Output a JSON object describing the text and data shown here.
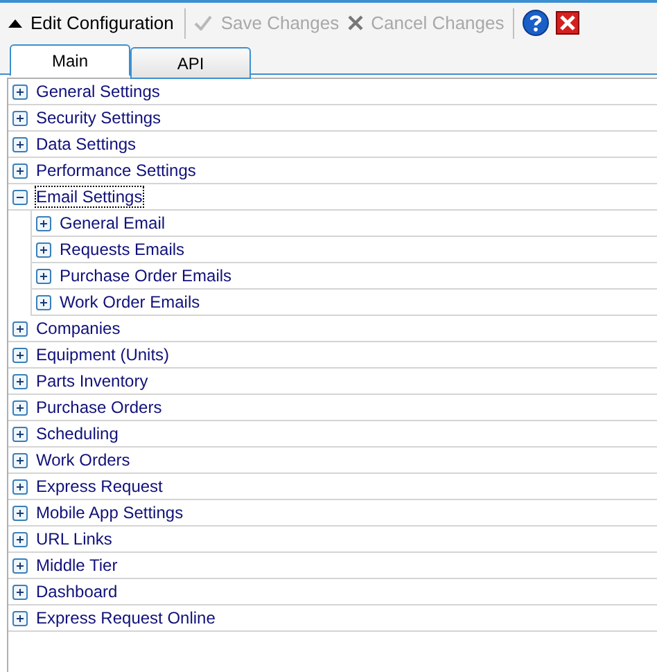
{
  "toolbar": {
    "title": "Edit Configuration",
    "expanded": true,
    "buttons": [
      {
        "kind": "save",
        "label": "Save Changes",
        "disabled": true
      },
      {
        "kind": "cancel",
        "label": "Cancel Changes",
        "disabled": true
      }
    ]
  },
  "tabs": [
    {
      "label": "Main",
      "selected": true
    },
    {
      "label": "API",
      "selected": false
    }
  ],
  "tree": [
    {
      "label": "General Settings",
      "expanded": false
    },
    {
      "label": "Security Settings",
      "expanded": false
    },
    {
      "label": "Data Settings",
      "expanded": false
    },
    {
      "label": "Performance Settings",
      "expanded": false
    },
    {
      "label": "Email Settings",
      "expanded": true,
      "focused": true,
      "children": [
        {
          "label": "General Email",
          "expanded": false
        },
        {
          "label": "Requests Emails",
          "expanded": false
        },
        {
          "label": "Purchase Order Emails",
          "expanded": false
        },
        {
          "label": "Work Order Emails",
          "expanded": false
        }
      ]
    },
    {
      "label": "Companies",
      "expanded": false
    },
    {
      "label": "Equipment (Units)",
      "expanded": false
    },
    {
      "label": "Parts Inventory",
      "expanded": false
    },
    {
      "label": "Purchase Orders",
      "expanded": false
    },
    {
      "label": "Scheduling",
      "expanded": false
    },
    {
      "label": "Work Orders",
      "expanded": false
    },
    {
      "label": "Express Request",
      "expanded": false
    },
    {
      "label": "Mobile App Settings",
      "expanded": false
    },
    {
      "label": "URL Links",
      "expanded": false
    },
    {
      "label": "Middle Tier",
      "expanded": false
    },
    {
      "label": "Dashboard",
      "expanded": false
    },
    {
      "label": "Express Request Online",
      "expanded": false
    }
  ]
}
